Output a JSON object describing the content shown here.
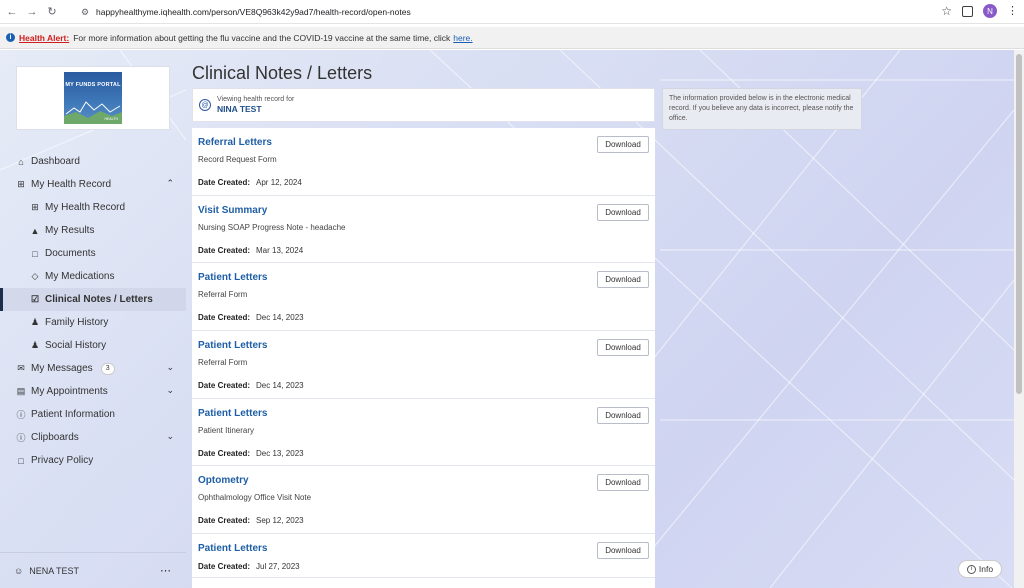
{
  "browser": {
    "url": "happyhealthyme.iqhealth.com/person/VE8Q963k42y9ad7/health-record/open-notes",
    "profile_initial": "N"
  },
  "alert": {
    "label": "Health Alert:",
    "text": "For more information about getting the flu vaccine and the COVID-19 vaccine at the same time, click",
    "link": "here."
  },
  "sidebar": {
    "logo_text": "MY FUNDS PORTAL",
    "logo_sub": "HEALTH",
    "items": [
      {
        "label": "Dashboard",
        "icon": "home-icon"
      },
      {
        "label": "My Health Record",
        "icon": "medical-record-icon"
      },
      {
        "label": "My Health Record",
        "icon": "medical-record-icon"
      },
      {
        "label": "My Results",
        "icon": "flask-icon"
      },
      {
        "label": "Documents",
        "icon": "document-icon"
      },
      {
        "label": "My Medications",
        "icon": "pill-icon"
      },
      {
        "label": "Clinical Notes / Letters",
        "icon": "clipboard-check-icon"
      },
      {
        "label": "Family History",
        "icon": "family-icon"
      },
      {
        "label": "Social History",
        "icon": "social-icon"
      },
      {
        "label": "My Messages",
        "icon": "mail-icon",
        "badge": "3"
      },
      {
        "label": "My Appointments",
        "icon": "calendar-icon"
      },
      {
        "label": "Patient Information",
        "icon": "info-icon"
      },
      {
        "label": "Clipboards",
        "icon": "info-icon"
      },
      {
        "label": "Privacy Policy",
        "icon": "document-icon"
      }
    ],
    "user": "NENA TEST"
  },
  "main": {
    "title": "Clinical Notes / Letters",
    "viewing_label": "Viewing health record for",
    "patient_name": "NINA TEST",
    "info_note": "The information provided below is in the electronic medical record. If you believe any data is incorrect, please notify the office.",
    "download_label": "Download",
    "date_label": "Date Created:",
    "notes": [
      {
        "title": "Referral Letters",
        "subtitle": "Record Request Form",
        "date": "Apr 12, 2024"
      },
      {
        "title": "Visit Summary",
        "subtitle": "Nursing SOAP Progress Note - headache",
        "date": "Mar 13, 2024"
      },
      {
        "title": "Patient Letters",
        "subtitle": "Referral Form",
        "date": "Dec 14, 2023"
      },
      {
        "title": "Patient Letters",
        "subtitle": "Referral Form",
        "date": "Dec 14, 2023"
      },
      {
        "title": "Patient Letters",
        "subtitle": "Patient Itinerary",
        "date": "Dec 13, 2023"
      },
      {
        "title": "Optometry",
        "subtitle": "Ophthalmology Office Visit Note",
        "date": "Sep 12, 2023"
      },
      {
        "title": "Patient Letters",
        "subtitle": "",
        "date": "Jul 27, 2023"
      }
    ],
    "info_button": "Info"
  }
}
